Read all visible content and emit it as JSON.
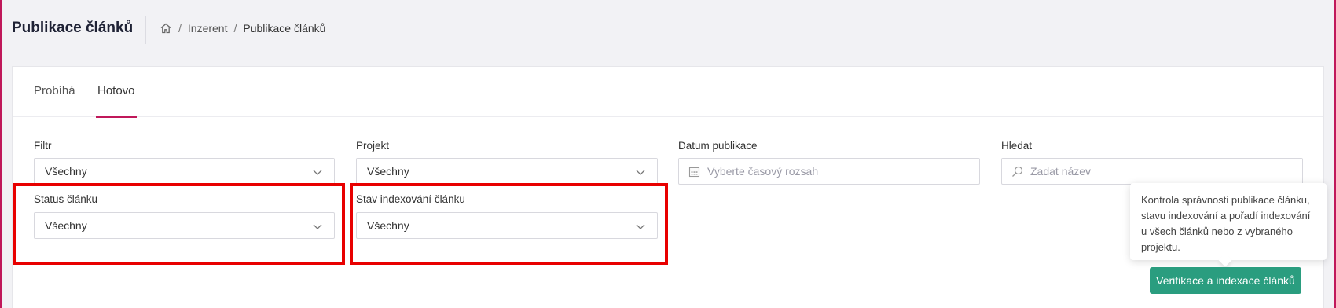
{
  "header": {
    "title": "Publikace článků",
    "breadcrumb": {
      "home_icon": "home-icon",
      "separator": "/",
      "items": [
        "Inzerent",
        "Publikace článků"
      ]
    }
  },
  "tabs": [
    {
      "label": "Probíhá",
      "active": false
    },
    {
      "label": "Hotovo",
      "active": true
    }
  ],
  "filters": {
    "filtr": {
      "label": "Filtr",
      "value": "Všechny"
    },
    "projekt": {
      "label": "Projekt",
      "value": "Všechny"
    },
    "datum": {
      "label": "Datum publikace",
      "placeholder": "Vyberte časový rozsah",
      "icon": "calendar-icon"
    },
    "hledat": {
      "label": "Hledat",
      "placeholder": "Zadat název",
      "icon": "search-icon"
    },
    "status": {
      "label": "Status článku",
      "value": "Všechny"
    },
    "stav_indexovani": {
      "label": "Stav indexování článku",
      "value": "Všechny"
    }
  },
  "tooltip": {
    "text": "Kontrola správnosti publikace článku, stavu indexování a pořadí indexování u všech článků nebo z vybraného projektu."
  },
  "actions": {
    "verify_label": "Verifikace a indexace článků"
  },
  "colors": {
    "accent": "#c0185a",
    "primary": "#2a9d7f",
    "highlight": "#e80000"
  }
}
